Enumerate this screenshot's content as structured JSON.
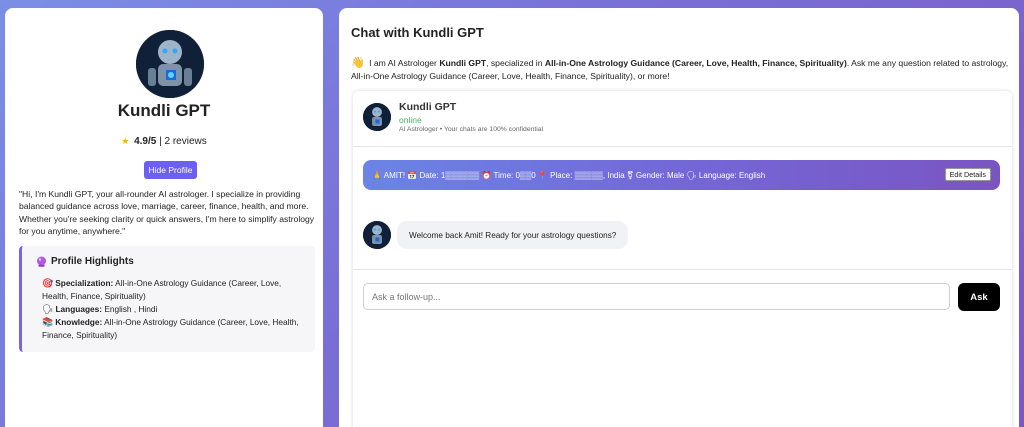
{
  "profile": {
    "name": "Kundli GPT",
    "rating_icon": "star-icon",
    "rating": "4.9/5",
    "reviews": "2 reviews",
    "rating_separator": "|",
    "hide_button": "Hide Profile",
    "bio": "\"Hi, I'm Kundli GPT, your all-rounder AI astrologer. I specialize in providing balanced guidance across love, marriage, career, finance, health, and more. Whether you're seeking clarity or quick answers, I'm here to simplify astrology for you anytime, anywhere.\"",
    "highlights": {
      "icon": "crystal-ball-icon",
      "title": "Profile Highlights",
      "specialization_label": "Specialization:",
      "specialization_value": "All-in-One Astrology Guidance (Career, Love, Health, Finance, Spirituality)",
      "languages_label": "Languages:",
      "languages_value": "English , Hindi",
      "knowledge_label": "Knowledge:",
      "knowledge_value": "All-in-One Astrology Guidance (Career, Love, Health, Finance, Spirituality)"
    }
  },
  "chat": {
    "title": "Chat with Kundli GPT",
    "intro_prefix": "I am AI Astrologer",
    "intro_name": "Kundli GPT",
    "intro_mid": ", specialized in",
    "intro_specialty": "All-in-One Astrology Guidance (Career, Love, Health, Finance, Spirituality)",
    "intro_suffix": ". Ask me any question related to astrology, All-in-One Astrology Guidance (Career, Love, Health, Finance, Spirituality), or more!",
    "header": {
      "name": "Kundli GPT",
      "status": "online",
      "subtitle": "AI Astrologer • Your chats are 100% confidential"
    },
    "details": {
      "text": "🙏 AMIT! 📅 Date: 1▒▒▒▒▒▒ ⏰ Time: 0▒▒0 📍 Place: ▒▒▒▒▒, India ⚧ Gender: Male 🗣 Language: English",
      "edit_button": "Edit Details"
    },
    "message": "Welcome back Amit!  Ready for your astrology questions?",
    "input_placeholder": "Ask a follow-up...",
    "ask_button": "Ask"
  },
  "colors": {
    "accent": "#6d5ff2",
    "online": "#3dbb5a",
    "border_accent": "#7b63e6"
  }
}
